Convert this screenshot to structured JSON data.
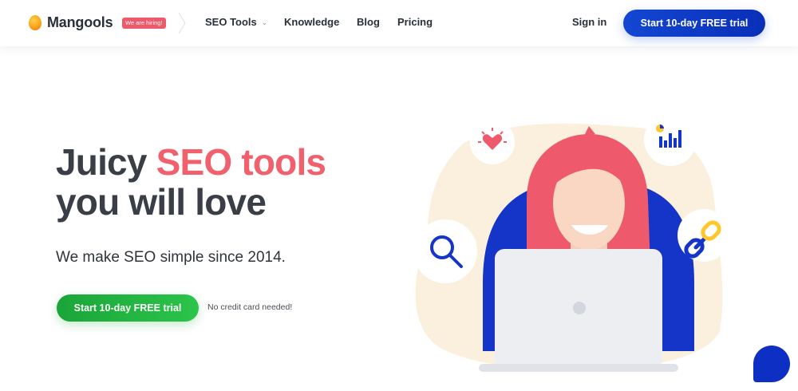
{
  "navbar": {
    "brand": "Mangools",
    "hiring_badge": "We are hiring!",
    "links": {
      "seo_tools": "SEO Tools",
      "knowledge": "Knowledge",
      "blog": "Blog",
      "pricing": "Pricing"
    },
    "sign_in": "Sign in",
    "cta": "Start 10-day FREE trial"
  },
  "hero": {
    "title_part1": "Juicy ",
    "title_accent": "SEO tools",
    "title_line2": "you will love",
    "subtitle": "We make SEO simple since 2014.",
    "cta": "Start 10-day FREE trial",
    "note": "No credit card needed!"
  },
  "colors": {
    "accent_red": "#f0616d",
    "primary_blue": "#1347d3",
    "cta_green": "#1aa538",
    "hiring_badge": "#ef5a6b"
  },
  "icons": {
    "logo": "mango-logo",
    "dropdown": "chevron-down-icon",
    "heart": "heart-icon",
    "chart": "bar-chart-icon",
    "search": "magnifier-icon",
    "link": "chain-link-icon",
    "chat": "chat-icon"
  }
}
